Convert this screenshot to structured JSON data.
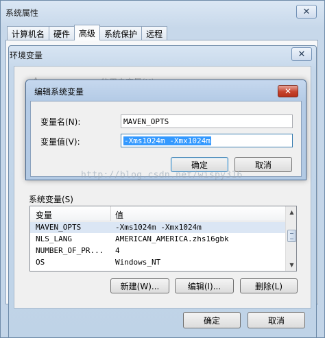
{
  "outer_window": {
    "title": "系统属性",
    "close_glyph": "✕",
    "tabs": [
      {
        "label": "计算机名"
      },
      {
        "label": "硬件"
      },
      {
        "label": "高级"
      },
      {
        "label": "系统保护"
      },
      {
        "label": "远程"
      }
    ],
    "ok_label": "确定",
    "cancel_label": "取消"
  },
  "env_window": {
    "title": "环境变量",
    "close_glyph": "✕",
    "user_vars_label_partial": "的用户变量(U)",
    "user_vars_prefix_partial": "A",
    "system_vars_label": "系统变量(S)",
    "table": {
      "columns": [
        "变量",
        "值"
      ],
      "rows": [
        {
          "name": "MAVEN_OPTS",
          "value": "-Xms1024m -Xmx1024m"
        },
        {
          "name": "NLS_LANG",
          "value": "AMERICAN_AMERICA.zhs16gbk"
        },
        {
          "name": "NUMBER_OF_PR...",
          "value": "4"
        },
        {
          "name": "OS",
          "value": "Windows_NT"
        }
      ],
      "selected_row": 0
    },
    "buttons": {
      "new_label": "新建(W)...",
      "edit_label": "编辑(I)...",
      "delete_label": "删除(L)"
    }
  },
  "edit_dialog": {
    "title": "编辑系统变量",
    "close_glyph": "✕",
    "name_label": "变量名(N):",
    "value_label": "变量值(V):",
    "name_value": "MAVEN_OPTS",
    "value_value": "-Xms1024m -Xmx1024m",
    "ok_label": "确定",
    "cancel_label": "取消"
  },
  "watermark": "http://blog.csdn.net/wispy316",
  "icons": {
    "scroll_up": "▲",
    "scroll_down": "▼"
  },
  "colors": {
    "selection_blue": "#3399ff",
    "close_red": "#c6432e",
    "title_bar_blue": "#b4cbe6"
  }
}
